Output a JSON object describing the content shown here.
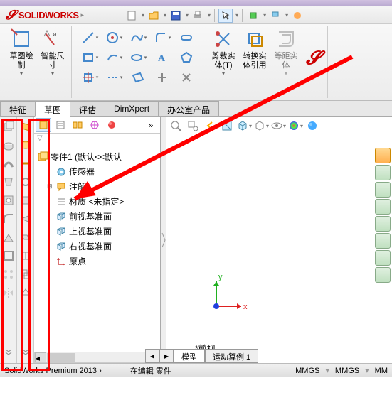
{
  "app": {
    "name": "SOLIDWORKS",
    "logo_letter": "S"
  },
  "qat_items": [
    "new",
    "open",
    "save",
    "print",
    "undo",
    "redo",
    "select",
    "rebuild",
    "options"
  ],
  "ribbon": {
    "big_buttons": [
      {
        "label": "草图绘\n制",
        "id": "sketch"
      },
      {
        "label": "智能尺\n寸",
        "id": "smart-dim"
      }
    ],
    "modify_buttons": [
      {
        "label": "剪裁实\n体(T)",
        "id": "trim"
      },
      {
        "label": "转换实\n体引用",
        "id": "convert"
      },
      {
        "label": "等距实\n体",
        "id": "offset",
        "disabled": true
      }
    ],
    "sketch_tools_count": 15
  },
  "main_tabs": [
    "特征",
    "草图",
    "评估",
    "DimXpert",
    "办公室产品"
  ],
  "main_active_tab": 1,
  "tree": {
    "root": "零件1  (默认<<默认",
    "items": [
      {
        "icon": "sensor",
        "label": "传感器"
      },
      {
        "icon": "annot",
        "label": "注解",
        "expandable": true
      },
      {
        "icon": "material",
        "label": "材质 <未指定>"
      },
      {
        "icon": "plane",
        "label": "前视基准面"
      },
      {
        "icon": "plane",
        "label": "上视基准面"
      },
      {
        "icon": "plane",
        "label": "右视基准面"
      },
      {
        "icon": "origin",
        "label": "原点"
      }
    ]
  },
  "filter_placeholder": "▼",
  "triad": {
    "x": "x",
    "y": "y"
  },
  "view_label": "*前视",
  "bottom_tabs": [
    "模型",
    "运动算例 1"
  ],
  "bottom_active": 0,
  "status": {
    "product": "SolidWorks Premium 2013 ›",
    "editing": "在编辑 零件",
    "units": [
      "MMGS",
      "MMGS",
      "MM"
    ]
  },
  "right_bar_count": 8,
  "colors": {
    "red": "#ff0000",
    "brand_red": "#cc0000",
    "axis_x": "#de2020",
    "axis_y": "#20b020",
    "axis_z": "#2040de"
  }
}
